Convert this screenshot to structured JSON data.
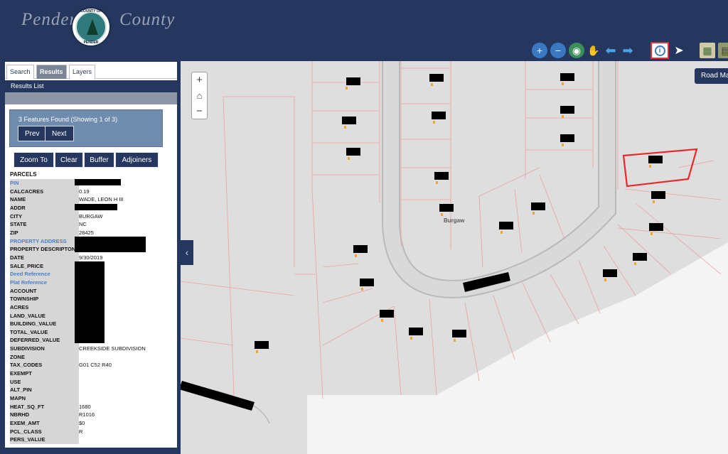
{
  "header": {
    "title_left": "Pender",
    "title_right": "County",
    "seal_top": "COUNTY OF",
    "seal_bottom": "PENDER"
  },
  "toolbar": {
    "tools": [
      "zoom-in-icon",
      "zoom-out-icon",
      "globe-icon",
      "pan-hand-icon",
      "back-arrow-icon",
      "forward-arrow-icon",
      "identify-info-icon",
      "select-pointer-icon",
      "map-icon",
      "print-icon"
    ]
  },
  "panel": {
    "tabs": [
      "Search",
      "Results",
      "Layers"
    ],
    "results_list_label": "Results List",
    "features_found": "3 Features Found (Showing 1 of 3)",
    "prev": "Prev",
    "next": "Next",
    "actions": [
      "Zoom To",
      "Clear",
      "Buffer",
      "Adjoiners"
    ],
    "parcels_title": "PARCELS",
    "attributes": [
      {
        "key": "PIN",
        "value": "",
        "link": true
      },
      {
        "key": "CALCACRES",
        "value": "0.19",
        "link": false
      },
      {
        "key": "NAME",
        "value": "WADE, LEON H III",
        "link": false
      },
      {
        "key": "ADDR",
        "value": "",
        "link": false
      },
      {
        "key": "CITY",
        "value": "BURGAW",
        "link": false
      },
      {
        "key": "STATE",
        "value": "NC",
        "link": false
      },
      {
        "key": "ZIP",
        "value": "28425",
        "link": false
      },
      {
        "key": "PROPERTY ADDRESS",
        "value": "",
        "link": true
      },
      {
        "key": "PROPERTY DESCRIPTON",
        "value": "",
        "link": false
      },
      {
        "key": "DATE",
        "value": "9/30/2019",
        "link": false
      },
      {
        "key": "SALE_PRICE",
        "value": "",
        "link": false
      },
      {
        "key": "Deed Reference",
        "value": "",
        "link": true
      },
      {
        "key": "Plat Reference",
        "value": "",
        "link": true
      },
      {
        "key": "ACCOUNT",
        "value": "",
        "link": false
      },
      {
        "key": "TOWNSHIP",
        "value": "",
        "link": false
      },
      {
        "key": "ACRES",
        "value": "",
        "link": false
      },
      {
        "key": "LAND_VALUE",
        "value": "",
        "link": false
      },
      {
        "key": "BUILDING_VALUE",
        "value": "",
        "link": false
      },
      {
        "key": "TOTAL_VALUE",
        "value": "",
        "link": false
      },
      {
        "key": "DEFERRED_VALUE",
        "value": "",
        "link": false
      },
      {
        "key": "SUBDIVISION",
        "value": "CREEKSIDE SUBDIVISION",
        "link": false
      },
      {
        "key": "ZONE",
        "value": "",
        "link": false
      },
      {
        "key": "TAX_CODES",
        "value": "G01 C52 R40",
        "link": false
      },
      {
        "key": "EXEMPT",
        "value": "",
        "link": false
      },
      {
        "key": "USE",
        "value": "",
        "link": false
      },
      {
        "key": "ALT_PIN",
        "value": "",
        "link": false
      },
      {
        "key": "MAPN",
        "value": "",
        "link": false
      },
      {
        "key": "HEAT_SQ_FT",
        "value": "1680",
        "link": false
      },
      {
        "key": "NBRHD",
        "value": "R1016",
        "link": false
      },
      {
        "key": "EXEM_AMT",
        "value": "$0",
        "link": false
      },
      {
        "key": "PCL_CLASS",
        "value": "R",
        "link": false
      },
      {
        "key": "PERS_VALUE",
        "value": "",
        "link": false
      }
    ]
  },
  "map": {
    "basemap_label": "Road Ma",
    "town_label": "Burgaw",
    "zoom_in": "+",
    "zoom_out": "−",
    "home_icon": "home-icon"
  },
  "colors": {
    "header_bg": "#25375e",
    "map_bg": "#dedede",
    "parcel_line": "#e9a3a3",
    "selected_parcel": "#e8282a"
  }
}
